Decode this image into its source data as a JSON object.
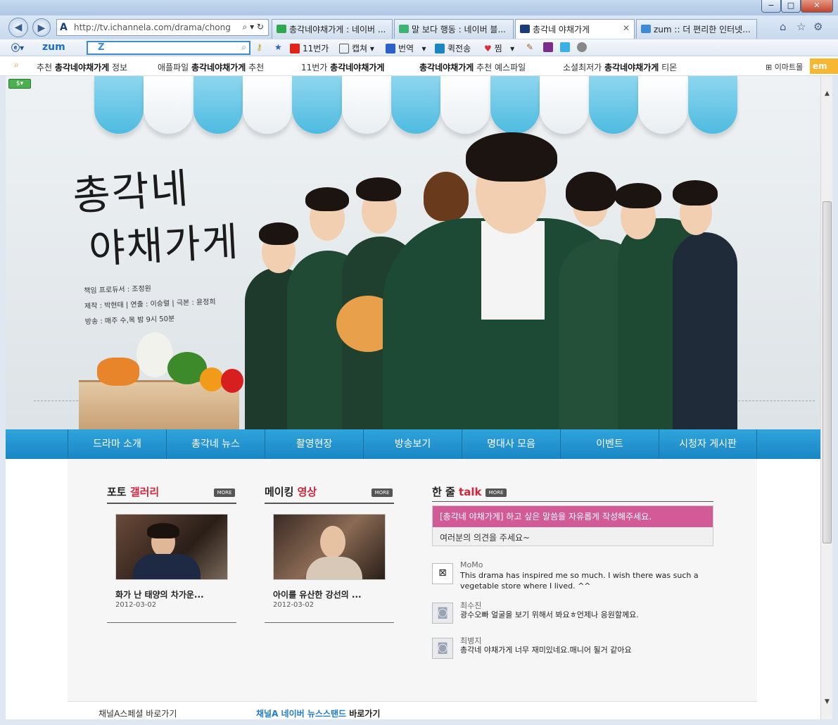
{
  "browser": {
    "window_controls": {
      "minimize": "−",
      "maximize": "□",
      "close": "✕"
    },
    "address": "http://tv.ichannela.com/drama/chonggak",
    "tabs": [
      {
        "label": "총각네야채가게 : 네이버 ...",
        "color": "#2fa84f"
      },
      {
        "label": "말 보다 행동 : 네이버 블...",
        "color": "#3cb371"
      },
      {
        "label": "총각네 야채가게",
        "color": "#1a3d7a"
      },
      {
        "label": "zum :: 더 편리한 인터넷...",
        "color": "#3d8ad6"
      }
    ],
    "tab_close": "✕",
    "toolbar": {
      "zum_logo": "zum",
      "search_prefix": "Z",
      "items": [
        "11번가",
        "캡쳐",
        "번역",
        "퀵전송",
        "찜"
      ]
    },
    "recommend": [
      {
        "prefix": "추천 ",
        "bold": "총각네야채가게",
        "suffix": " 정보"
      },
      {
        "prefix": "애플파일 ",
        "bold": "총각네야채가게",
        "suffix": " 추천"
      },
      {
        "prefix": "11번가 ",
        "bold": "총각네야채가게",
        "suffix": ""
      },
      {
        "prefix": "",
        "bold": "총각네야채가게",
        "suffix": " 추천 예스파일"
      },
      {
        "prefix": "소셜최저가 ",
        "bold": "총각네야채가게",
        "suffix": " 티몬"
      }
    ],
    "emart_label": "이마트몰",
    "emart_badge": "em"
  },
  "hero": {
    "logo_line1": "총각네",
    "logo_line2": "야채가게",
    "credits": [
      "책임 프로듀서 : 조정원",
      "제작 : 박현태 | 연출 : 이승렬 | 극본 : 윤정희",
      "방송 : 매주 수,목 밤 9시 50분"
    ]
  },
  "menu": [
    "드라마 소개",
    "총각네 뉴스",
    "촬영현장",
    "방송보기",
    "명대사 모음",
    "이벤트",
    "시청자 게시판"
  ],
  "photo": {
    "title_a": "포토 ",
    "title_b": "갤러리",
    "more": "MORE",
    "caption": "화가 난 태양의 차가운...",
    "date": "2012-03-02"
  },
  "making": {
    "title_a": "메이킹 ",
    "title_b": "영상",
    "more": "MORE",
    "caption": "아이를 유산한 강선의 ...",
    "date": "2012-03-02"
  },
  "talk": {
    "title_a": "한 줄 ",
    "title_b": "talk",
    "more": "MORE",
    "highlight": "[총각네 야채가게] 하고 싶은 말씀을 자유롭게 작성해주세요.",
    "sub": "여러분의 의견을 주세요~",
    "comments": [
      {
        "name": "MoMo",
        "text": "This drama has inspired me so much. I wish there was such a vegetable store where I lived. ^^"
      },
      {
        "name": "최수진",
        "text": "광수오빠 얼굴을 보기 위해서 봐요ㅎ언제나 응원할께요."
      },
      {
        "name": "최병지",
        "text": "총각네 야채가게 너무 재미있네요.매니어 될거 같아요"
      }
    ]
  },
  "footer": {
    "link1": "채널A스페셜 바로가기",
    "link2_blue": "채널A 네이버 뉴스스탠드",
    "link2_rest": " 바로가기"
  },
  "colors": {
    "menu_blue": "#1a86c4",
    "accent_red": "#d1243d",
    "talk_pink": "#d25a97",
    "awning_blue": "#4dbbe0"
  }
}
